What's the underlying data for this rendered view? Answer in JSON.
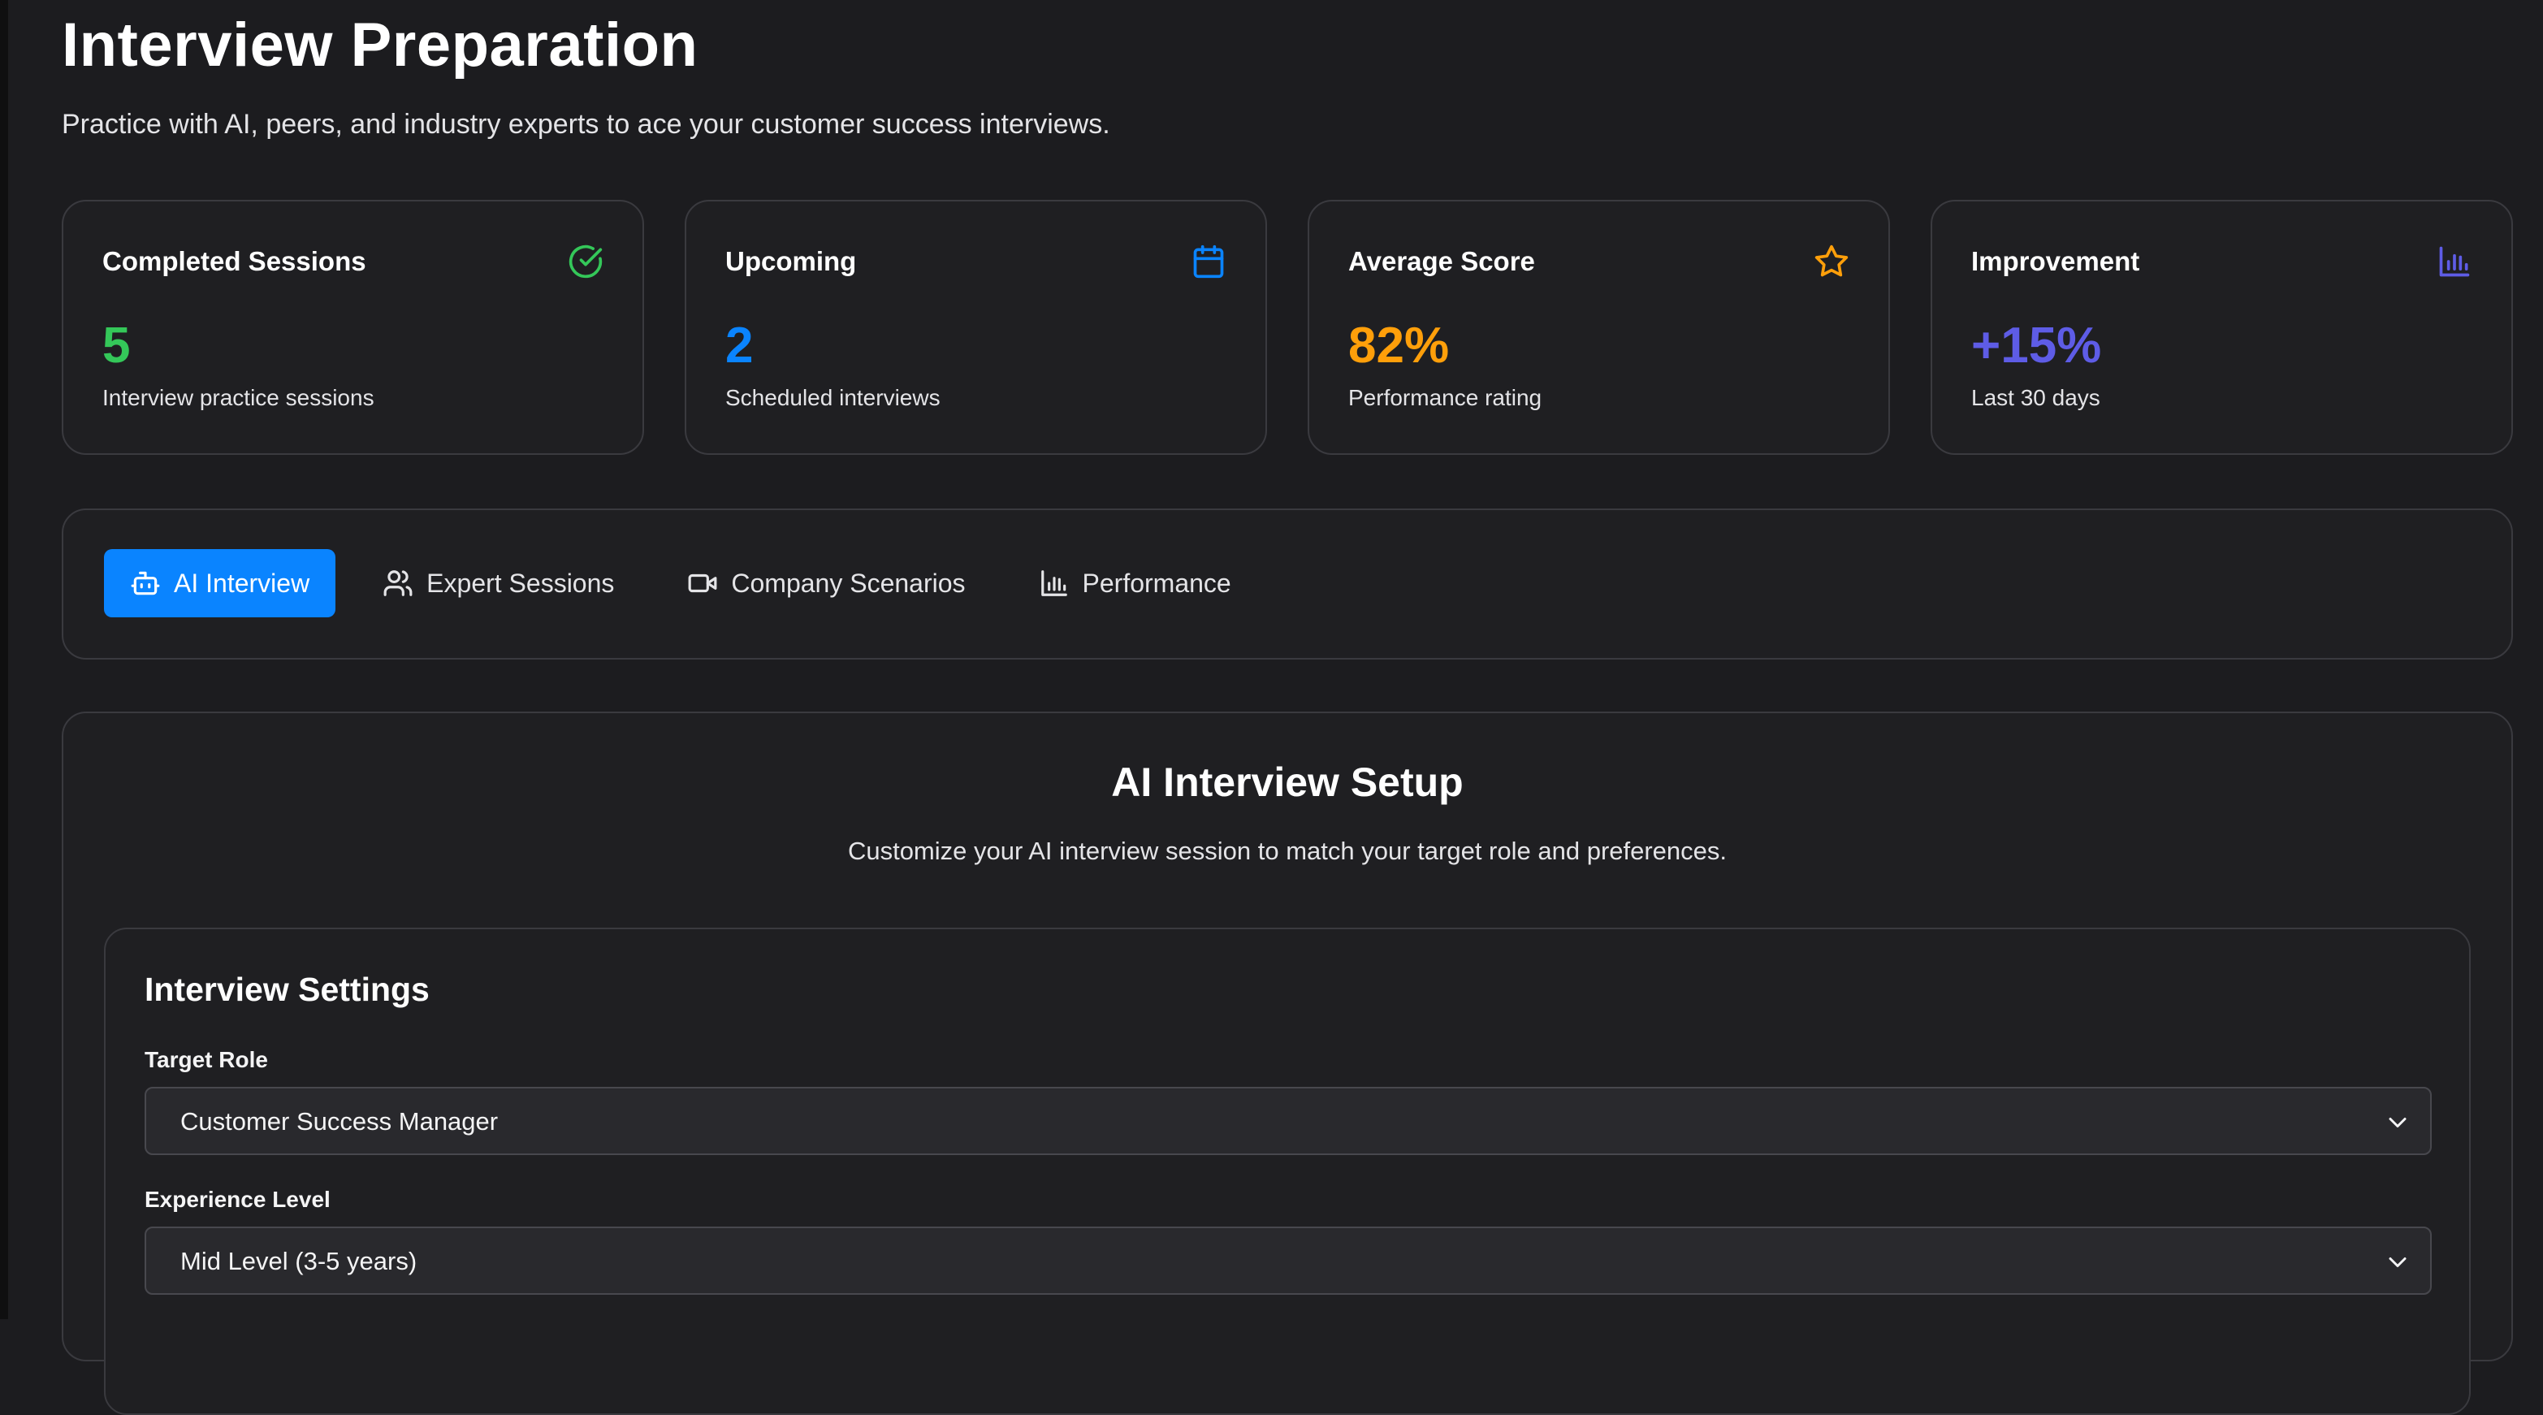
{
  "header": {
    "title": "Interview Preparation",
    "subtitle": "Practice with AI, peers, and industry experts to ace your customer success interviews."
  },
  "stats": [
    {
      "title": "Completed Sessions",
      "value": "5",
      "caption": "Interview practice sessions",
      "icon": "check-circle-icon",
      "color": "#34c759"
    },
    {
      "title": "Upcoming",
      "value": "2",
      "caption": "Scheduled interviews",
      "icon": "calendar-icon",
      "color": "#0a84ff"
    },
    {
      "title": "Average Score",
      "value": "82%",
      "caption": "Performance rating",
      "icon": "star-icon",
      "color": "#ff9f0a"
    },
    {
      "title": "Improvement",
      "value": "+15%",
      "caption": "Last 30 days",
      "icon": "bar-chart-icon",
      "color": "#5e5ce6"
    }
  ],
  "tabs": [
    {
      "label": "AI Interview",
      "icon": "robot-icon",
      "active": true
    },
    {
      "label": "Expert Sessions",
      "icon": "users-icon",
      "active": false
    },
    {
      "label": "Company Scenarios",
      "icon": "video-icon",
      "active": false
    },
    {
      "label": "Performance",
      "icon": "bar-chart-icon",
      "active": false
    }
  ],
  "setup": {
    "title": "AI Interview Setup",
    "subtitle": "Customize your AI interview session to match your target role and preferences.",
    "settings": {
      "title": "Interview Settings",
      "fields": [
        {
          "label": "Target Role",
          "value": "Customer Success Manager"
        },
        {
          "label": "Experience Level",
          "value": "Mid Level (3-5 years)"
        }
      ]
    }
  },
  "colors": {
    "accent": "#0a84ff",
    "background": "#1c1c1f",
    "card": "#1f1f22",
    "border": "#3a3a3f"
  }
}
